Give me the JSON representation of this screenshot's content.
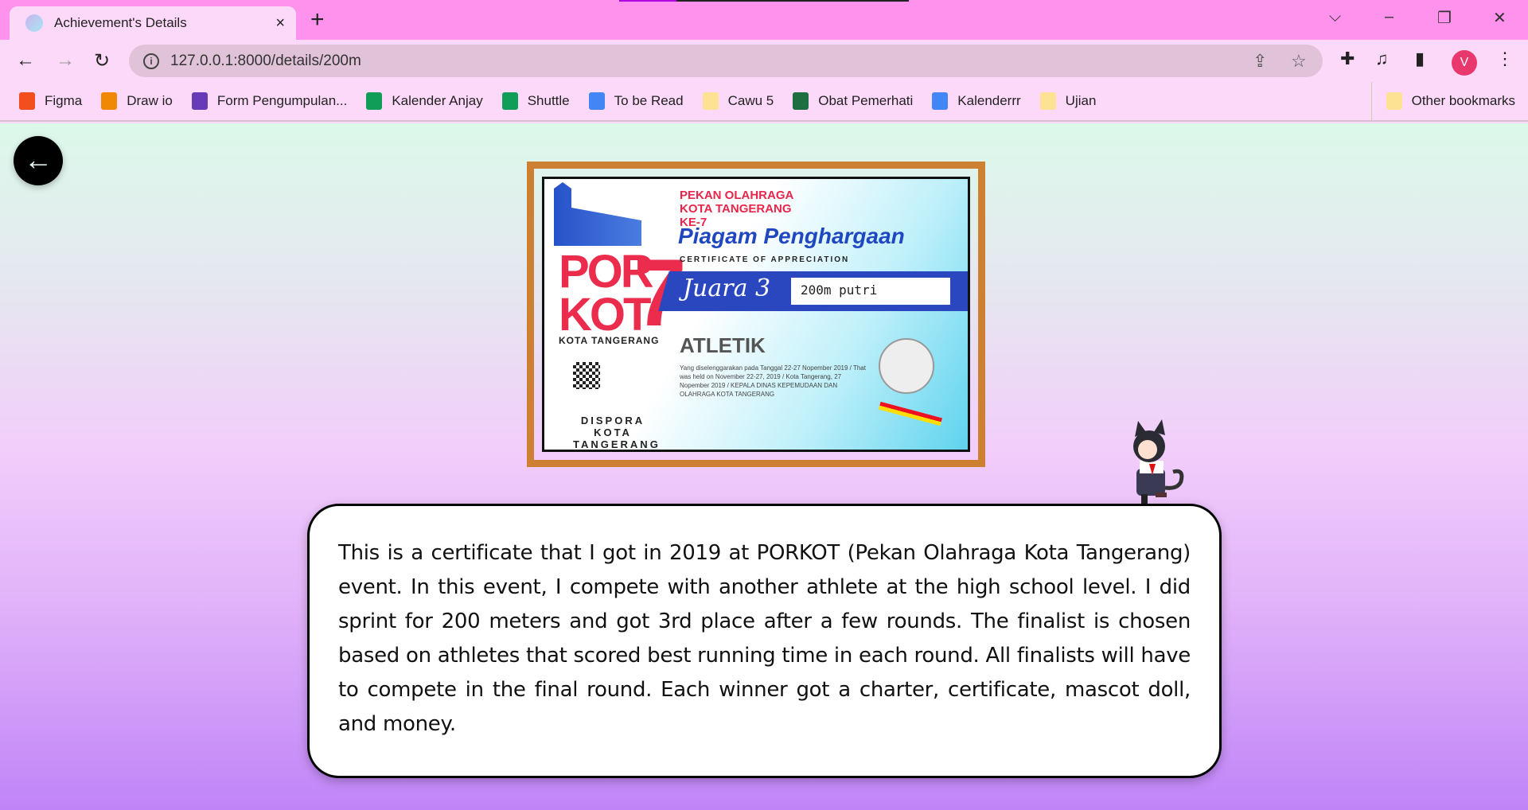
{
  "browser": {
    "tab_title": "Achievement's Details",
    "tab_close": "×",
    "new_tab": "+",
    "url": "127.0.0.1:8000/details/200m",
    "profile_initial": "V",
    "window_controls": {
      "dropdown": "⌵",
      "minimize": "–",
      "restore": "❐",
      "close": "✕"
    },
    "bookmarks": [
      {
        "label": "Figma",
        "icon": "figma-icon",
        "color": "#f24e1e"
      },
      {
        "label": "Draw io",
        "icon": "drawio-icon",
        "color": "#f08705"
      },
      {
        "label": "Form Pengumpulan...",
        "icon": "google-forms-icon",
        "color": "#673ab7"
      },
      {
        "label": "Kalender Anjay",
        "icon": "google-sheets-icon",
        "color": "#0f9d58"
      },
      {
        "label": "Shuttle",
        "icon": "google-sheets-icon",
        "color": "#0f9d58"
      },
      {
        "label": "To be Read",
        "icon": "google-docs-icon",
        "color": "#4285f4"
      },
      {
        "label": "Cawu 5",
        "icon": "folder-icon",
        "color": "#fde293"
      },
      {
        "label": "Obat Pemerhati",
        "icon": "excel-icon",
        "color": "#1d6f42"
      },
      {
        "label": "Kalenderrr",
        "icon": "google-calendar-icon",
        "color": "#4285f4"
      },
      {
        "label": "Ujian",
        "icon": "folder-icon",
        "color": "#fde293"
      }
    ],
    "other_bookmarks": "Other bookmarks"
  },
  "page": {
    "back_icon": "arrow-left-icon",
    "certificate": {
      "header": "PEKAN OLAHRAGA KOTA TANGERANG KE-7",
      "title": "Piagam Penghargaan",
      "subtitle": "CERTIFICATE OF APPRECIATION",
      "logo_por": "POR",
      "logo_kot": "KOT",
      "logo_seven": "7",
      "logo_city": "KOTA TANGERANG",
      "rank": "Juara 3",
      "event": "200m putri",
      "sport": "ATLETIK",
      "details": "Yang diselenggarakan pada Tanggal 22-27 Nopember 2019 / That was held on November 22-27, 2019 / Kota Tangerang, 27 Nopember 2019 / KEPALA DINAS KEPEMUDAAN DAN OLAHRAGA KOTA TANGERANG",
      "org": "DISPORA KOTA TANGERANG"
    },
    "description": "This is a certificate that I got in 2019 at PORKOT (Pekan Olahraga Kota Tangerang) event. In this event, I compete with another athlete at the high school level. I did sprint for 200 meters and got 3rd place after a few rounds. The finalist is chosen based on athletes that scored best running time in each round. All finalists will have to compete in the final round. Each winner got a charter, certificate, mascot doll, and money.",
    "colors": {
      "frame": "#cd7f32",
      "gradient_top": "#dcf9ea",
      "gradient_mid": "#f2cdfb",
      "gradient_bottom": "#c084f8"
    }
  }
}
